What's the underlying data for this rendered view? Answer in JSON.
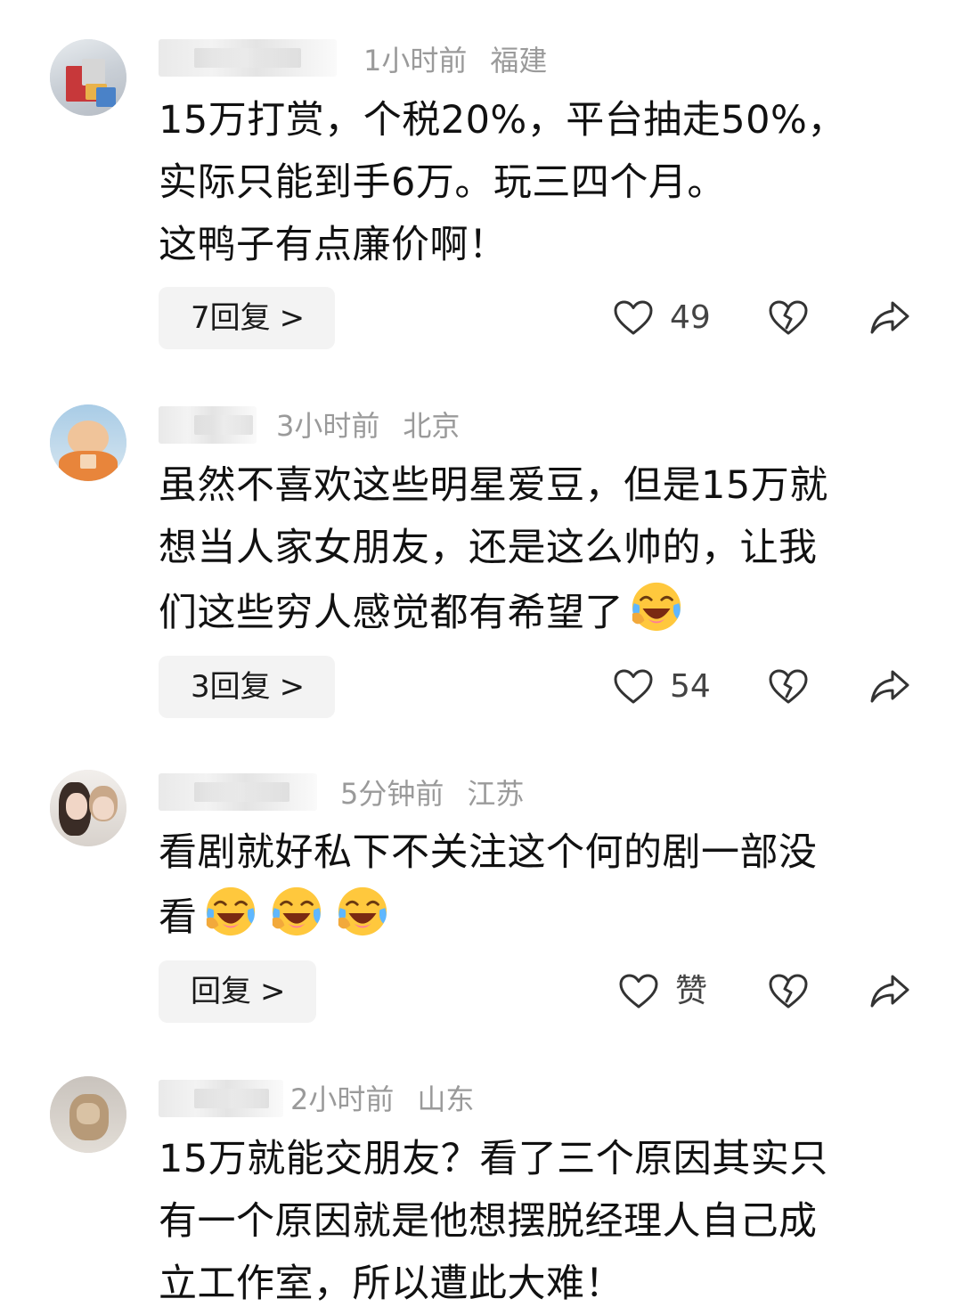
{
  "comments": [
    {
      "time": "1小时前",
      "location": "福建",
      "lines": [
        "15万打赏，个税20%，平台抽走50%，",
        "实际只能到手6万。玩三四个月。",
        "这鸭子有点廉价啊！"
      ],
      "reply_label": "7回复",
      "reply_chevron": ">",
      "like_count": "49"
    },
    {
      "time": "3小时前",
      "location": "北京",
      "lines": [
        "虽然不喜欢这些明星爱豆，但是15万就",
        "想当人家女朋友，还是这么帅的，让我",
        "们这些穷人感觉都有希望了"
      ],
      "reply_label": "3回复",
      "reply_chevron": ">",
      "like_count": "54"
    },
    {
      "time": "5分钟前",
      "location": "江苏",
      "lines": [
        "看剧就好私下不关注这个何的剧一部没",
        "看"
      ],
      "reply_label": "回复",
      "reply_chevron": ">",
      "like_count": "赞"
    },
    {
      "time": "2小时前",
      "location": "山东",
      "lines": [
        "15万就能交朋友？看了三个原因其实只",
        "有一个原因就是他想摆脱经理人自己成",
        "立工作室，所以遭此大难！"
      ]
    }
  ],
  "icons": {
    "like": "heart-outline-icon",
    "dislike": "broken-heart-icon",
    "share": "share-arrow-icon",
    "emoji": "laughing-crying-emoji"
  },
  "colors": {
    "meta_text": "#9a9a9a",
    "body_text": "#111111",
    "reply_bg": "#f3f3f3",
    "icon_stroke": "#333333"
  }
}
